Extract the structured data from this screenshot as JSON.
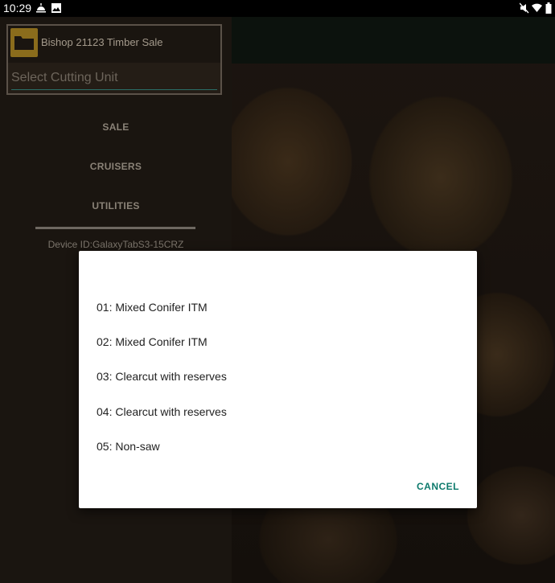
{
  "status_bar": {
    "time": "10:29",
    "left_icons": [
      "weather-icon",
      "image-icon"
    ],
    "right_icons": [
      "mute-icon",
      "wifi-icon",
      "battery-icon"
    ]
  },
  "sale": {
    "name": "Bishop 21123 Timber Sale",
    "cutting_unit_placeholder": "Select Cutting Unit"
  },
  "menu": {
    "items": [
      "SALE",
      "CRUISERS",
      "UTILITIES"
    ]
  },
  "device_id": "Device ID:GalaxyTabS3-15CRZ",
  "dialog": {
    "options": [
      "01: Mixed Conifer ITM",
      "02: Mixed Conifer ITM",
      "03: Clearcut with reserves",
      "04: Clearcut with reserves",
      "05: Non-saw"
    ],
    "cancel_label": "CANCEL"
  },
  "colors": {
    "accent": "#0d7a6c",
    "folder": "#8a6c1c"
  }
}
